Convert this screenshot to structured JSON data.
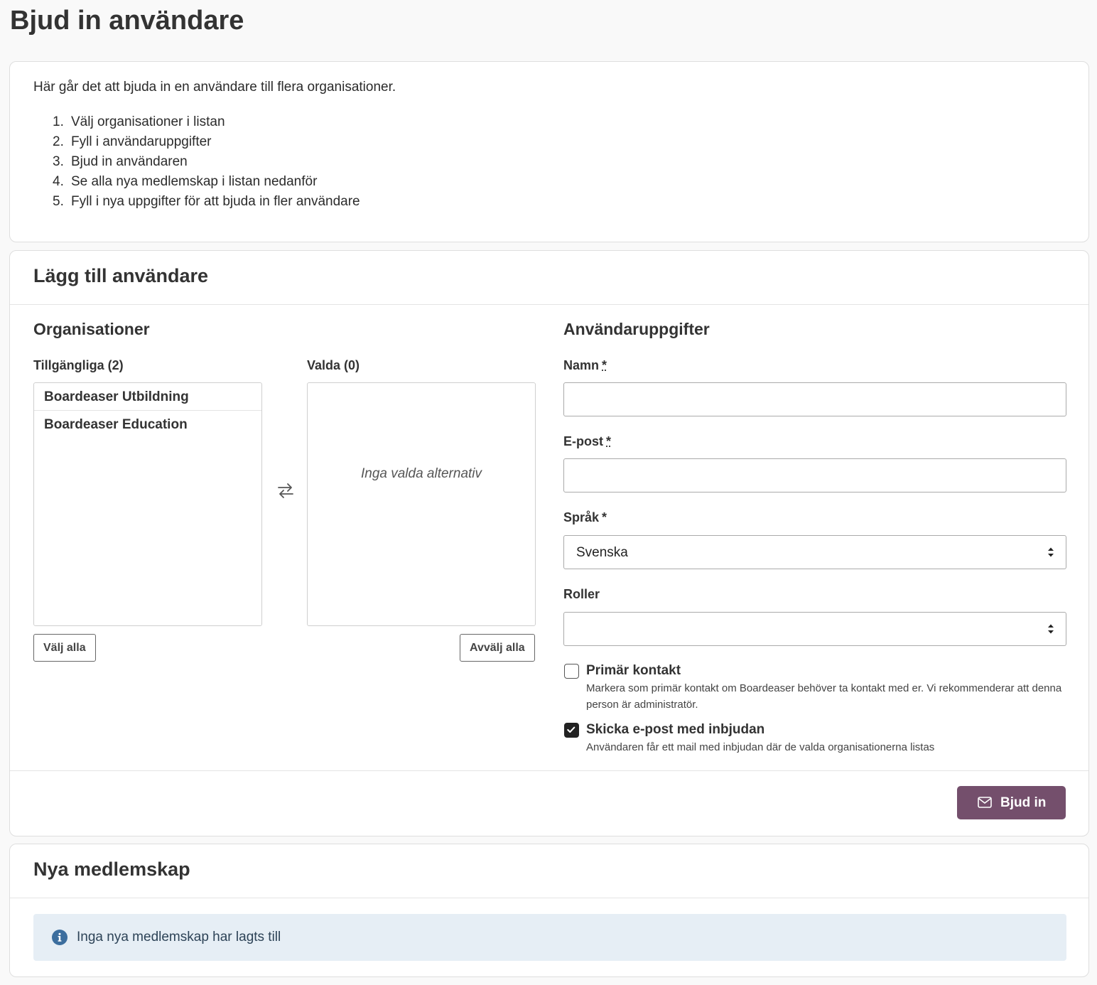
{
  "page": {
    "title": "Bjud in användare"
  },
  "intro": {
    "text": "Här går det att bjuda in en användare till flera organisationer.",
    "steps": [
      {
        "num": "1.",
        "text": "Välj organisationer i listan"
      },
      {
        "num": "2.",
        "text": "Fyll i användaruppgifter"
      },
      {
        "num": "3.",
        "text": "Bjud in användaren"
      },
      {
        "num": "4.",
        "text": "Se alla nya medlemskap i listan nedanför"
      },
      {
        "num": "5.",
        "text": "Fyll i nya uppgifter för att bjuda in fler användare"
      }
    ]
  },
  "add_user": {
    "title": "Lägg till användare",
    "organizations": {
      "title": "Organisationer",
      "available_label": "Tillgängliga (2)",
      "selected_label": "Valda (0)",
      "available_items": [
        "Boardeaser Utbildning",
        "Boardeaser Education"
      ],
      "empty_text": "Inga valda alternativ",
      "select_all": "Välj alla",
      "deselect_all": "Avvälj alla"
    },
    "details": {
      "title": "Användaruppgifter",
      "name_label": "Namn",
      "email_label": "E-post",
      "language_label": "Språk",
      "roles_label": "Roller",
      "required_mark": "*",
      "name_value": "",
      "email_value": "",
      "language_value": "Svenska",
      "roles_value": "",
      "primary_contact": {
        "label": "Primär kontakt",
        "help": "Markera som primär kontakt om Boardeaser behöver ta kontakt med er. Vi rekommenderar att denna person är administratör.",
        "checked": false
      },
      "send_email": {
        "label": "Skicka e-post med inbjudan",
        "help": "Användaren får ett mail med inbjudan där de valda organisationerna listas",
        "checked": true
      }
    },
    "invite_button": "Bjud in"
  },
  "memberships": {
    "title": "Nya medlemskap",
    "empty_text": "Inga nya medlemskap har lagts till"
  },
  "colors": {
    "primary": "#744f6c",
    "alert_bg": "#e6eef5",
    "info_icon": "#3c6e9e"
  },
  "icons": {
    "swap": "swap-arrows-icon",
    "invite": "envelope-icon",
    "info": "info-circle-icon",
    "select": "select-arrows-icon",
    "check": "checkmark-icon"
  }
}
